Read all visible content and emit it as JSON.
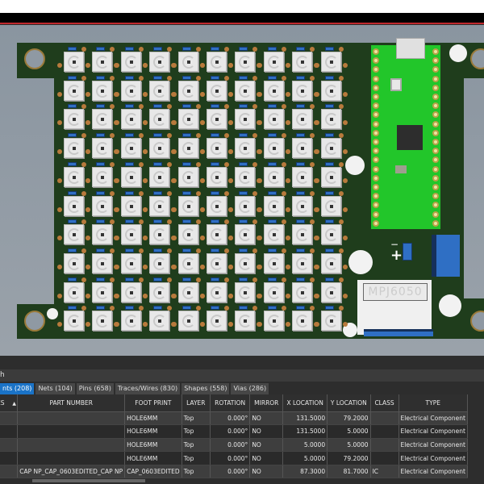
{
  "colors": {
    "board": "#1f3d1c",
    "pico": "#22c62a",
    "accent": "#1a73c7",
    "toolbar_stripe": "#c0282d"
  },
  "board": {
    "module_silkscreen": "MPJ6050",
    "polarity_minus": "−",
    "polarity_plus": "+"
  },
  "panel": {
    "title": "h",
    "tabs": [
      {
        "label": "nts (208)",
        "active": true
      },
      {
        "label": "Nets (104)"
      },
      {
        "label": "Pins (658)"
      },
      {
        "label": "Traces/Wires (830)"
      },
      {
        "label": "Shapes (558)"
      },
      {
        "label": "Vias (286)"
      }
    ],
    "columns": [
      "EFDES",
      "PART NUMBER",
      "FOOT PRINT",
      "LAYER",
      "ROTATION",
      "MIRROR",
      "X LOCATION",
      "Y LOCATION",
      "CLASS",
      "TYPE"
    ],
    "sort_icon": "sort-ascending-icon",
    "rows": [
      [
        "",
        "",
        "HOLE6MM",
        "Top",
        "0.000°",
        "NO",
        "131.5000",
        "79.2000",
        "",
        "Electrical Component"
      ],
      [
        "",
        "",
        "HOLE6MM",
        "Top",
        "0.000°",
        "NO",
        "131.5000",
        "5.0000",
        "",
        "Electrical Component"
      ],
      [
        "",
        "",
        "HOLE6MM",
        "Top",
        "0.000°",
        "NO",
        "5.0000",
        "5.0000",
        "",
        "Electrical Component"
      ],
      [
        "",
        "",
        "HOLE6MM",
        "Top",
        "0.000°",
        "NO",
        "5.0000",
        "79.2000",
        "",
        "Electrical Component"
      ],
      [
        "",
        "CAP NP_CAP_0603EDITED_CAP NP",
        "CAP_0603EDITED",
        "Top",
        "0.000°",
        "NO",
        "87.3000",
        "81.7000",
        "IC",
        "Electrical Component"
      ]
    ]
  }
}
